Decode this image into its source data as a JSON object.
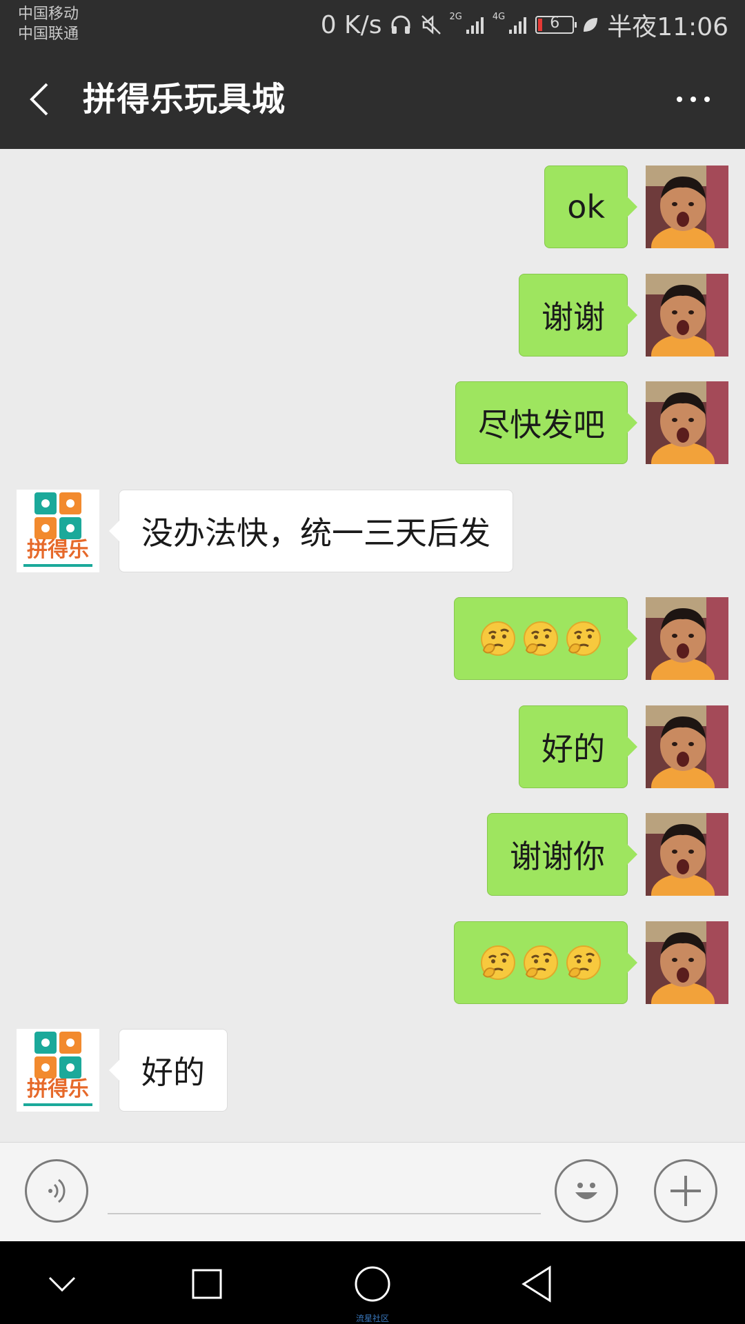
{
  "status_bar": {
    "carrier_1": "中国移动",
    "carrier_2": "中国联通",
    "net_speed": "0 K/s",
    "sig1_label": "2G",
    "sig2_label": "4G",
    "battery": "6",
    "time": "半夜11:06"
  },
  "header": {
    "title": "拼得乐玩具城"
  },
  "shop_logo_text": "拼得乐",
  "messages": [
    {
      "side": "right",
      "type": "text",
      "text": "ok"
    },
    {
      "side": "right",
      "type": "text",
      "text": "谢谢"
    },
    {
      "side": "right",
      "type": "text",
      "text": "尽快发吧"
    },
    {
      "side": "left",
      "type": "text",
      "text": "没办法快，统一三天后发"
    },
    {
      "side": "right",
      "type": "emoji",
      "emoji": "thinking-face-icon",
      "count": 3
    },
    {
      "side": "right",
      "type": "text",
      "text": "好的"
    },
    {
      "side": "right",
      "type": "text",
      "text": "谢谢你"
    },
    {
      "side": "right",
      "type": "emoji",
      "emoji": "thinking-face-icon",
      "count": 3
    },
    {
      "side": "left",
      "type": "text",
      "text": "好的"
    }
  ],
  "input": {
    "value": "",
    "placeholder": ""
  },
  "watermark": "流星社区",
  "colors": {
    "sent_bubble": "#9ee55f",
    "received_bubble": "#ffffff",
    "bars": "#2e2e2e",
    "background": "#ebebeb"
  }
}
